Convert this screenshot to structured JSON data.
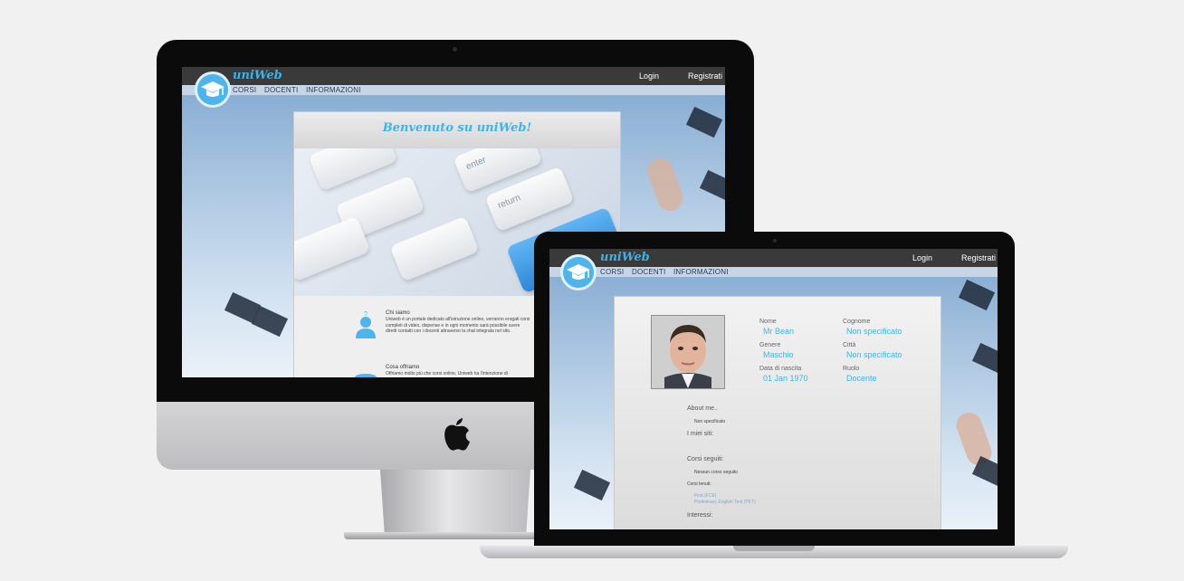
{
  "site": {
    "brand": "uniWeb",
    "nav": {
      "login": "Login",
      "register": "Registrati"
    },
    "menu": [
      "CORSI",
      "DOCENTI",
      "INFORMAZIONI"
    ]
  },
  "home": {
    "welcome": "Benvenuto su uniWeb!",
    "keys": [
      "enter",
      "return",
      "le"
    ],
    "sections": [
      {
        "title": "Chi siamo",
        "text": "Uniweb è un portale dedicato all'istruzione online, verranno erogati corsi completi di video, dispense e in ogni momento sarà possibile avere diretti contatti con i docenti attraverso la chat integrata nel sito."
      },
      {
        "title": "Cosa offriamo",
        "text": "Offriamo molto più che corsi online, Uniweb ha l'intenzione di"
      }
    ]
  },
  "profile": {
    "fields": [
      {
        "label": "Nome",
        "value": "Mr Bean"
      },
      {
        "label": "Cognome",
        "value": "Non specificato"
      },
      {
        "label": "Genere",
        "value": "Maschio"
      },
      {
        "label": "Città",
        "value": "Non specificato"
      },
      {
        "label": "Data di nascita",
        "value": "01 Jan 1970"
      },
      {
        "label": "Ruolo",
        "value": "Docente"
      }
    ],
    "about_label": "About me..",
    "about_value": "Non specificato",
    "sites_label": "I miei siti:",
    "followed_label": "Corsi seguiti:",
    "followed_value": "Nessun corso seguito",
    "held_label": "Corsi tenuti:",
    "held_courses": [
      "First (FCE)",
      "Preliminary English Test (PET)"
    ],
    "interests_label": "Interessi:"
  },
  "colors": {
    "accent": "#3eb3ea",
    "navbar": "#3a3a3a"
  }
}
